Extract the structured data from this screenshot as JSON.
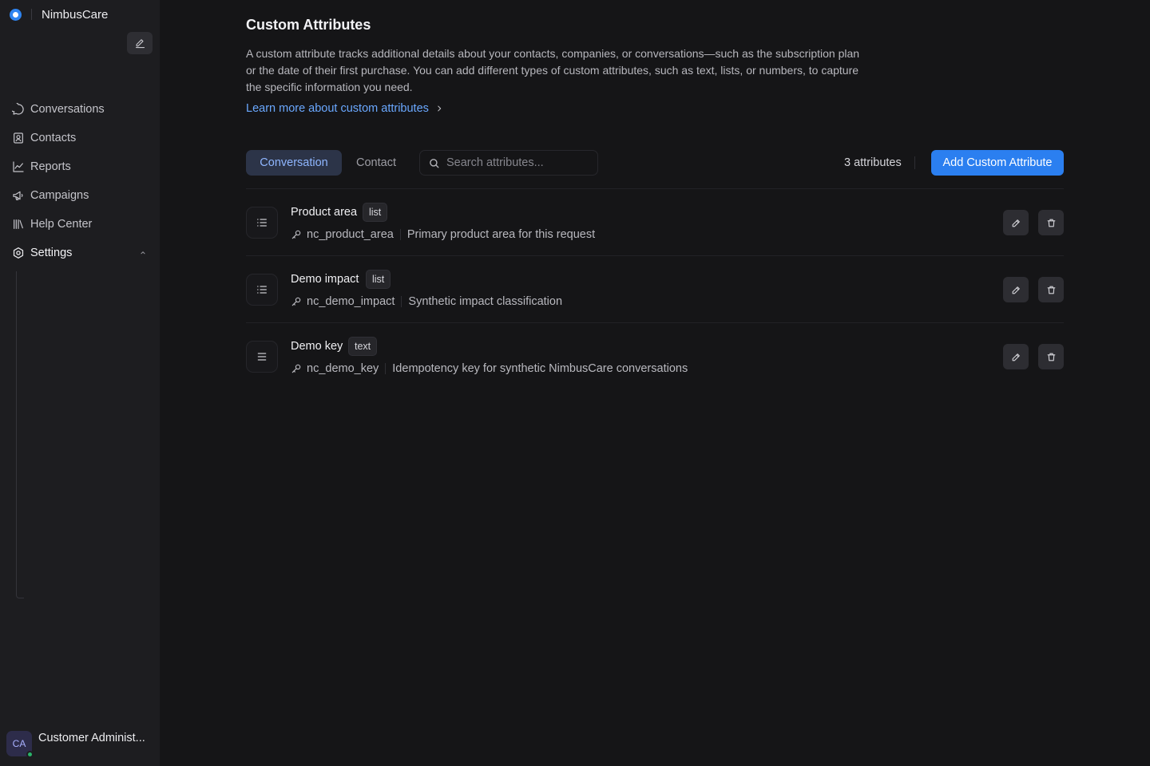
{
  "brand": {
    "name": "NimbusCare"
  },
  "sidebar": {
    "items": [
      {
        "label": "Conversations",
        "icon": "chat-bubble-icon"
      },
      {
        "label": "Contacts",
        "icon": "contact-card-icon"
      },
      {
        "label": "Reports",
        "icon": "line-chart-icon"
      },
      {
        "label": "Campaigns",
        "icon": "megaphone-icon"
      },
      {
        "label": "Help Center",
        "icon": "library-icon"
      },
      {
        "label": "Settings",
        "icon": "settings-icon",
        "expanded": true
      }
    ]
  },
  "user": {
    "initials": "CA",
    "name": "Customer Administ...",
    "status": "online"
  },
  "page": {
    "title": "Custom Attributes",
    "description": "A custom attribute tracks additional details about your contacts, companies, or conversations—such as the subscription plan or the date of their first purchase. You can add different types of custom attributes, such as text, lists, or numbers, to capture the specific information you need.",
    "learn_more": "Learn more about custom attributes"
  },
  "toolbar": {
    "tabs": [
      {
        "label": "Conversation",
        "active": true
      },
      {
        "label": "Contact",
        "active": false
      }
    ],
    "search_placeholder": "Search attributes...",
    "count_label": "3 attributes",
    "add_label": "Add Custom Attribute"
  },
  "attributes": [
    {
      "name": "Product area",
      "type": "list",
      "key": "nc_product_area",
      "description": "Primary product area for this request",
      "icon": "list-icon"
    },
    {
      "name": "Demo impact",
      "type": "list",
      "key": "nc_demo_impact",
      "description": "Synthetic impact classification",
      "icon": "list-icon"
    },
    {
      "name": "Demo key",
      "type": "text",
      "key": "nc_demo_key",
      "description": "Idempotency key for synthetic NimbusCare conversations",
      "icon": "text-lines-icon"
    }
  ],
  "colors": {
    "accent": "#2b7ff0",
    "link": "#6aa8ff",
    "background": "#151517",
    "sidebar": "#1d1d20",
    "status_online": "#2ab36a"
  }
}
